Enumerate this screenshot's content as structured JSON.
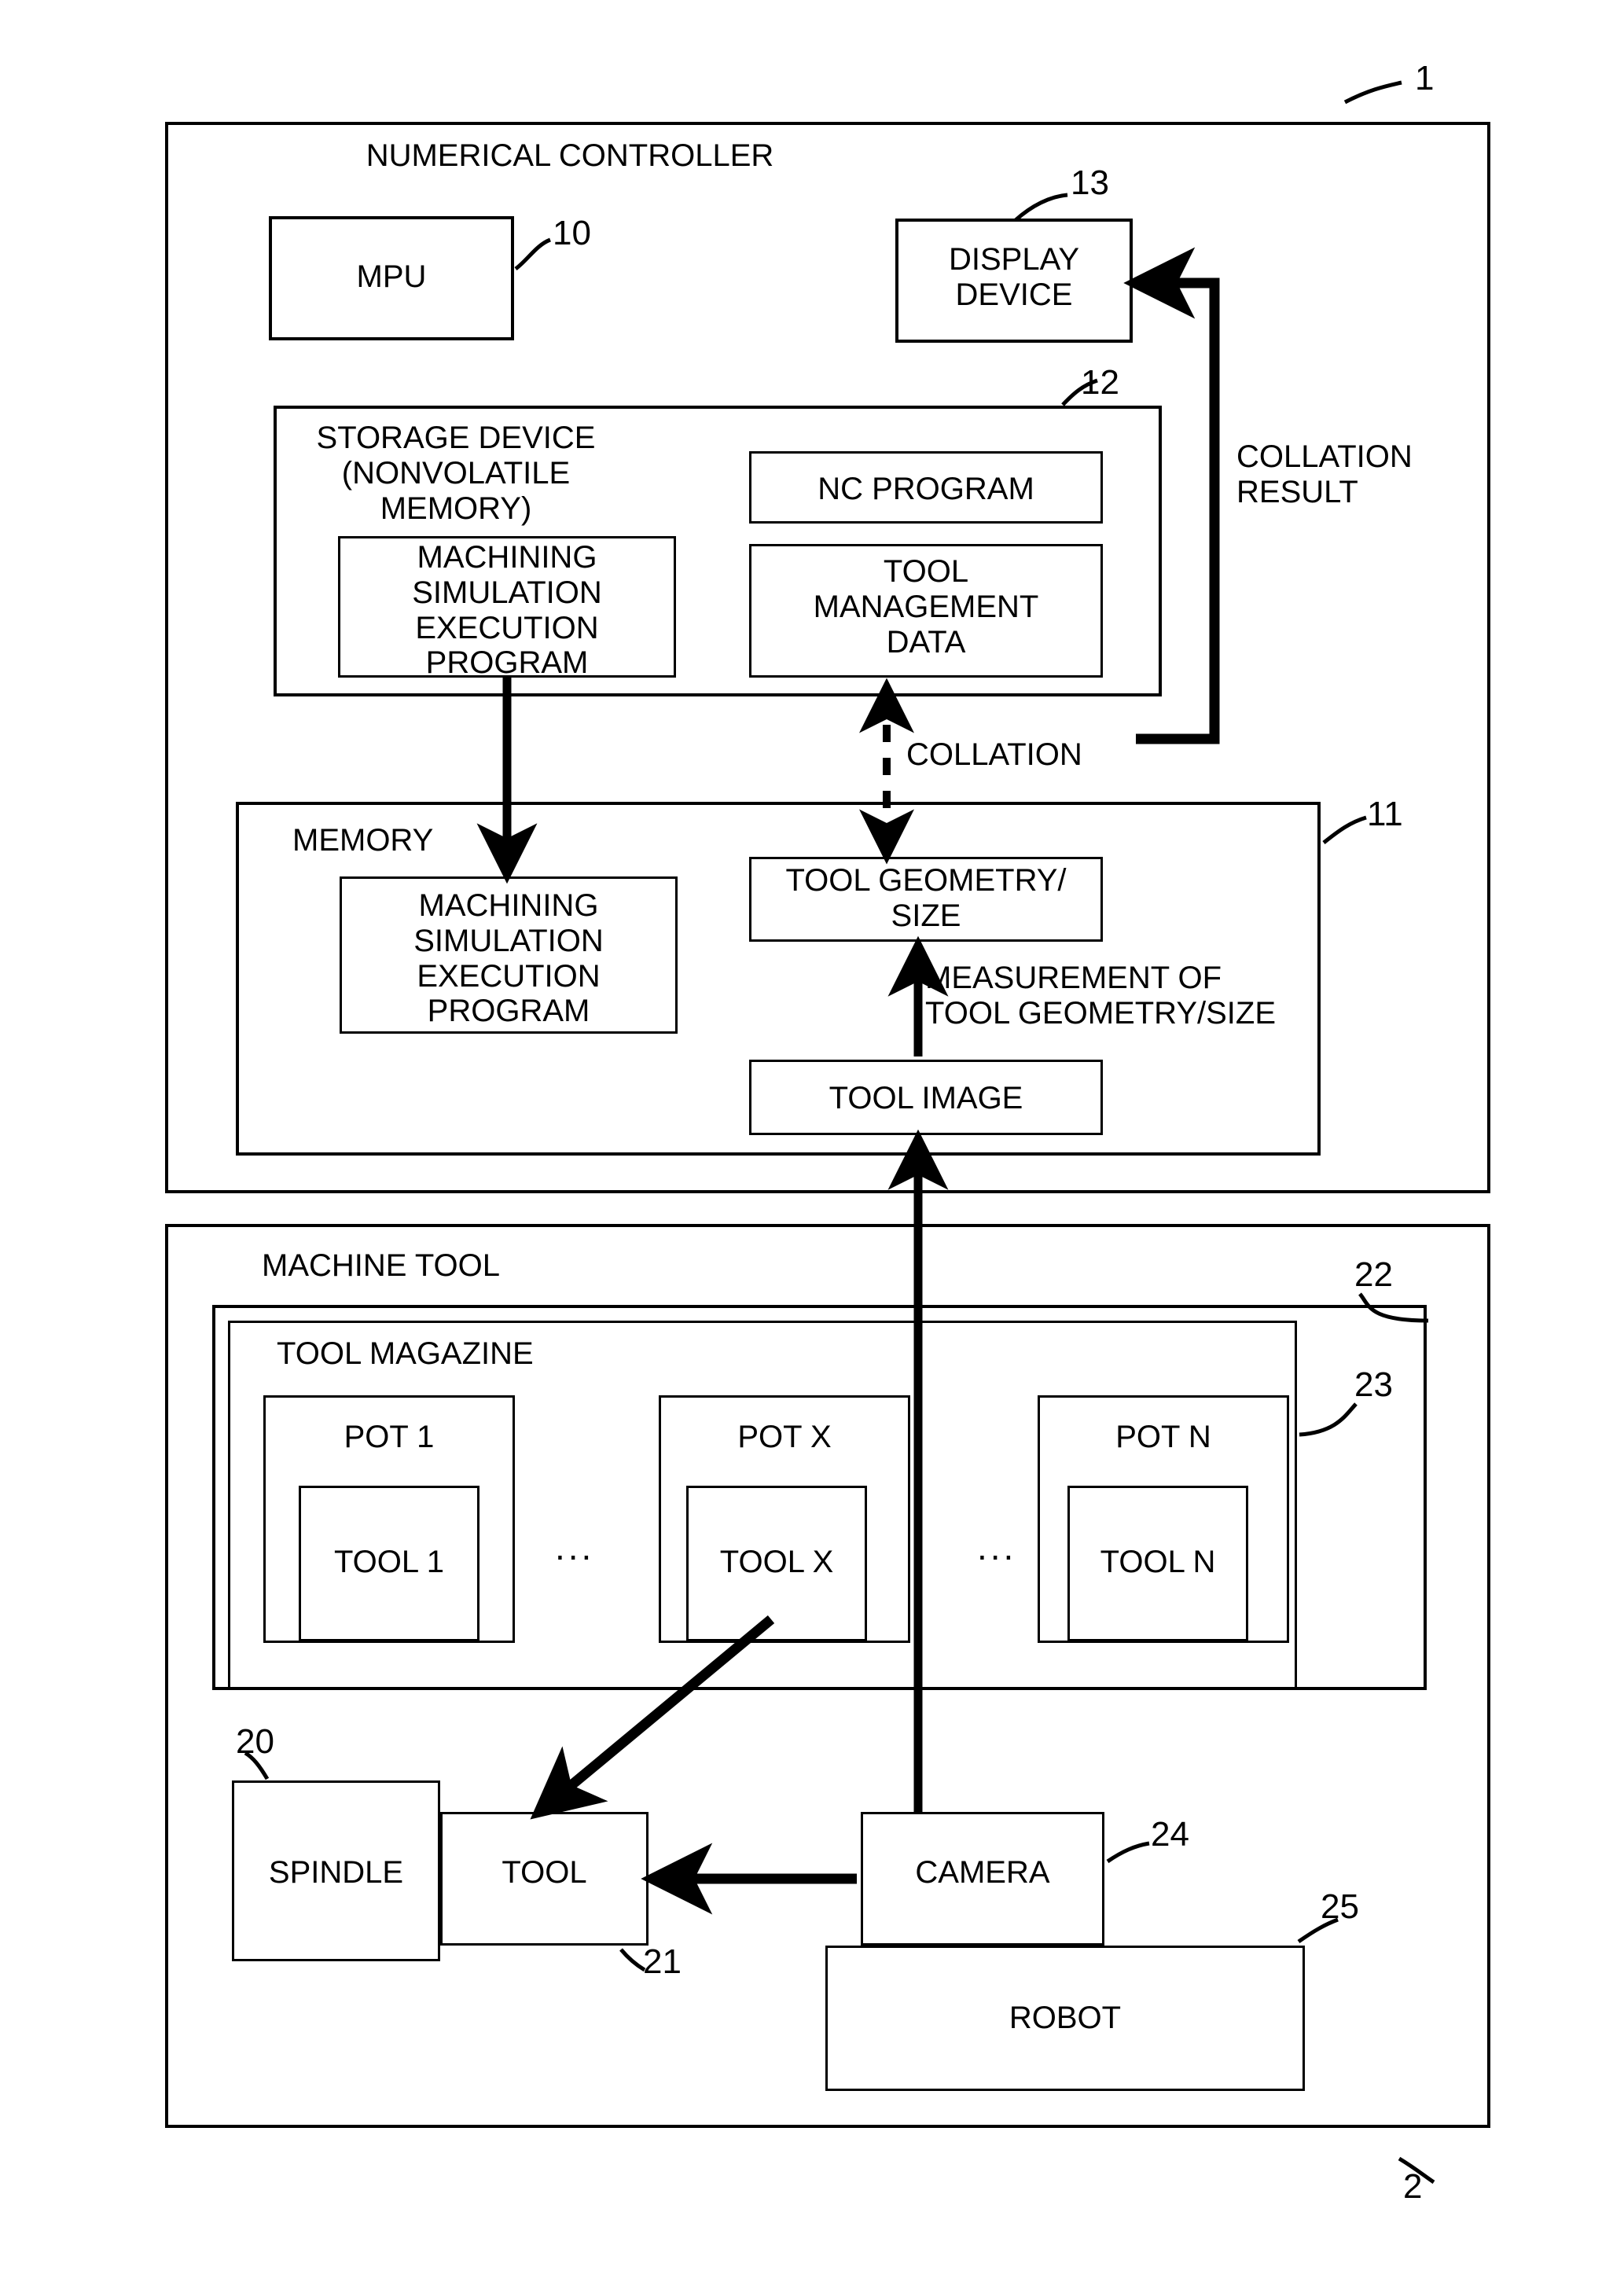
{
  "figure": {
    "outer_blocks": [
      {
        "id": "numerical-controller",
        "title": "NUMERICAL CONTROLLER",
        "ref": "1"
      },
      {
        "id": "machine-tool",
        "title": "MACHINE TOOL",
        "ref": "2"
      }
    ]
  },
  "controller": {
    "title": "NUMERICAL CONTROLLER",
    "ref": "1",
    "mpu": {
      "label": "MPU",
      "ref": "10"
    },
    "display_device": {
      "label": "DISPLAY\nDEVICE",
      "ref": "13"
    },
    "collation_result_label": "COLLATION\nRESULT",
    "storage_device": {
      "title": "STORAGE DEVICE\n(NONVOLATILE\nMEMORY)",
      "ref": "12",
      "items": [
        {
          "label": "NC PROGRAM"
        },
        {
          "label": "MACHINING\nSIMULATION\nEXECUTION\nPROGRAM"
        },
        {
          "label": "TOOL\nMANAGEMENT\nDATA"
        }
      ]
    },
    "collation_label": "COLLATION",
    "memory": {
      "title": "MEMORY",
      "ref": "11",
      "items": [
        {
          "label": "MACHINING\nSIMULATION\nEXECUTION\nPROGRAM"
        },
        {
          "label": "TOOL GEOMETRY/\nSIZE"
        },
        {
          "label": "TOOL IMAGE"
        }
      ],
      "measurement_label": "MEASUREMENT OF\nTOOL GEOMETRY/SIZE"
    }
  },
  "machine": {
    "title": "MACHINE TOOL",
    "ref": "2",
    "magazine_outer_ref": "22",
    "magazine": {
      "title": "TOOL MAGAZINE",
      "ref": "23",
      "pots": [
        {
          "pot_label": "POT 1",
          "tool_label": "TOOL 1"
        },
        {
          "pot_label": "POT X",
          "tool_label": "TOOL X"
        },
        {
          "pot_label": "POT N",
          "tool_label": "TOOL N"
        }
      ],
      "ellipsis": "..."
    },
    "spindle": {
      "label": "SPINDLE",
      "ref": "20"
    },
    "tool": {
      "label": "TOOL",
      "ref": "21"
    },
    "camera": {
      "label": "CAMERA",
      "ref": "24"
    },
    "robot": {
      "label": "ROBOT",
      "ref": "25"
    }
  },
  "colors": {
    "line": "#000000",
    "background": "#ffffff"
  }
}
